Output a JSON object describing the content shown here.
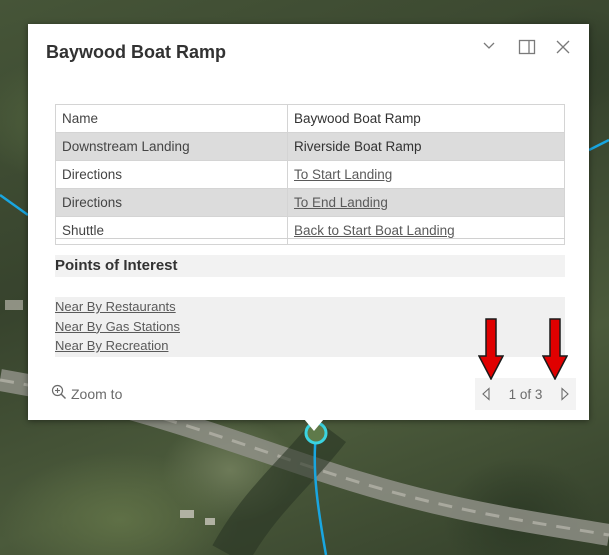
{
  "popup": {
    "title": "Baywood Boat Ramp",
    "header_icons": [
      "chevron-down-icon",
      "dock-icon",
      "close-icon"
    ]
  },
  "attributes": [
    {
      "key": "Name",
      "value": "Baywood Boat Ramp",
      "link": false
    },
    {
      "key": "Downstream Landing",
      "value": "Riverside Boat Ramp",
      "link": false
    },
    {
      "key": "Directions",
      "value": "To Start Landing",
      "link": true
    },
    {
      "key": "Directions",
      "value": "To End Landing",
      "link": true
    },
    {
      "key": "Shuttle",
      "value": "Back to Start Boat Landing",
      "link": true
    }
  ],
  "poi": {
    "heading": "Points of Interest",
    "links": [
      "Near By Restaurants",
      "Near By Gas Stations",
      "Near By Recreation"
    ]
  },
  "footer": {
    "zoom_label": "Zoom to",
    "pager_text": "1 of 3"
  },
  "colors": {
    "annotation_arrow": "#e00000",
    "river_line": "#19a6e0",
    "marker_ring": "#3bd3e0"
  }
}
